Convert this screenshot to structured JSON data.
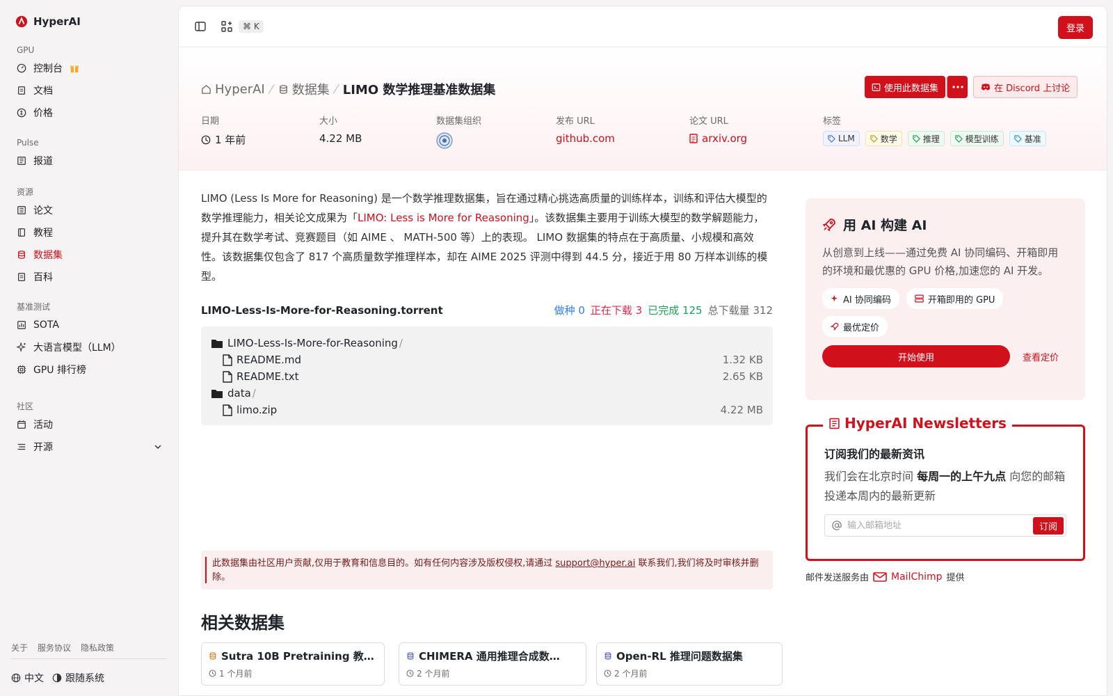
{
  "brand": {
    "name": "HyperAI"
  },
  "sidebar": {
    "groups": [
      {
        "label": "GPU",
        "items": [
          {
            "label": "控制台"
          },
          {
            "label": "文档"
          },
          {
            "label": "价格"
          }
        ]
      },
      {
        "label": "Pulse",
        "items": [
          {
            "label": "报道"
          }
        ]
      },
      {
        "label": "资源",
        "items": [
          {
            "label": "论文"
          },
          {
            "label": "教程"
          },
          {
            "label": "数据集"
          },
          {
            "label": "百科"
          }
        ]
      },
      {
        "label": "基准测试",
        "items": [
          {
            "label": "SOTA"
          },
          {
            "label": "大语言模型（LLM）"
          },
          {
            "label": "GPU 排行榜"
          }
        ]
      },
      {
        "label": "社区",
        "items": [
          {
            "label": "活动"
          },
          {
            "label": "开源"
          }
        ]
      }
    ],
    "footer_links": [
      "关于",
      "服务协议",
      "隐私政策"
    ],
    "language": "中文",
    "theme": "跟随系统"
  },
  "topbar": {
    "shortcut": "⌘ K",
    "login_label": "登录"
  },
  "breadcrumb": {
    "home": "HyperAI",
    "section": "数据集",
    "current": "LIMO 数学推理基准数据集"
  },
  "actions": {
    "use_dataset": "使用此数据集",
    "discord": "在 Discord 上讨论"
  },
  "meta": {
    "date": {
      "label": "日期",
      "value": "1 年前"
    },
    "size": {
      "label": "大小",
      "value": "4.22 MB"
    },
    "org": {
      "label": "数据集组织"
    },
    "publish_url": {
      "label": "发布 URL",
      "value": "github.com"
    },
    "paper_url": {
      "label": "论文 URL",
      "value": "arxiv.org"
    },
    "tags": {
      "label": "标签",
      "items": [
        "LLM",
        "数学",
        "推理",
        "模型训练",
        "基准"
      ]
    }
  },
  "description": {
    "part1": "LIMO (Less Is More for Reasoning) 是一个数学推理数据集，旨在通过精心挑选高质量的训练样本，训练和评估大模型的数学推理能力，相关论文成果为「",
    "link": "LIMO: Less is More for Reasoning",
    "part2": "」。该数据集主要用于训练大模型的数学解题能力，提升其在数学考试、竞赛题目（如 AIME 、 MATH-500 等）上的表现。 LIMO 数据集的特点在于高质量、小规模和高效性。该数据集仅包含了 817 个高质量数学推理样本，却在 AIME 2025 评测中得到 44.5 分，接近于用 80 万样本训练的模型。"
  },
  "torrent": {
    "name": "LIMO-Less-Is-More-for-Reasoning.torrent",
    "seeds": "做种 0",
    "downloading": "正在下载 3",
    "completed": "已完成 125",
    "total": "总下载量 312",
    "tree": [
      {
        "type": "folder",
        "name": "LIMO-Less-Is-More-for-Reasoning",
        "size": ""
      },
      {
        "type": "file",
        "name": "README.md",
        "size": "1.32 KB"
      },
      {
        "type": "file",
        "name": "README.txt",
        "size": "2.65 KB"
      },
      {
        "type": "folder",
        "name": "data",
        "size": ""
      },
      {
        "type": "file",
        "name": "limo.zip",
        "size": "4.22 MB"
      }
    ]
  },
  "notice": {
    "text1": "此数据集由社区用户贡献,仅用于教育和信息目的。如有任何内容涉及版权侵权,请通过 ",
    "email": "support@hyper.ai",
    "text2": " 联系我们,我们将及时审核并删除。"
  },
  "related": {
    "title": "相关数据集",
    "items": [
      {
        "title": "Sutra 10B Pretraining 教…",
        "date": "1 个月前"
      },
      {
        "title": "CHIMERA 通用推理合成数…",
        "date": "2 个月前"
      },
      {
        "title": "Open-RL 推理问题数据集",
        "date": "2 个月前"
      }
    ]
  },
  "ai_card": {
    "title": "用 AI 构建 AI",
    "desc": "从创意到上线——通过免费 AI 协同编码、开箱即用的环境和最优惠的 GPU 价格,加速您的 AI 开发。",
    "chips": [
      "AI 协同编码",
      "开箱即用的 GPU",
      "最优定价"
    ],
    "start": "开始使用",
    "pricing": "查看定价"
  },
  "newsletter": {
    "legend": "HyperAI Newsletters",
    "subtitle": "订阅我们的最新资讯",
    "text1": "我们会在北京时间 ",
    "bold": "每周一的上午九点",
    "text2": " 向您的邮箱投递本周内的最新更新",
    "placeholder": "输入邮箱地址",
    "subscribe": "订阅",
    "note1": "邮件发送服务由",
    "provider": "MailChimp",
    "note2": "提供"
  },
  "colors": {
    "accent": "#d0101b"
  }
}
